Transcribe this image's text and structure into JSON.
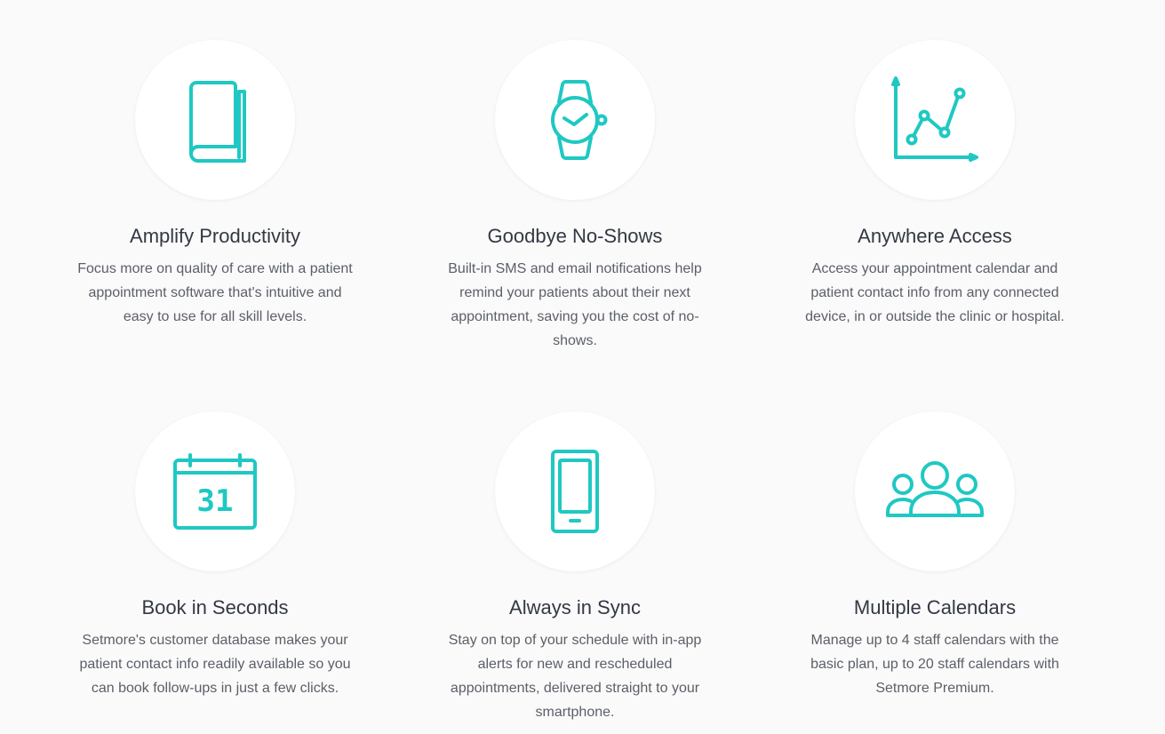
{
  "accent_color": "#1fc8c3",
  "features": [
    {
      "icon": "book-icon",
      "title": "Amplify Productivity",
      "description": "Focus more on quality of care with a patient appointment software that's intuitive and easy to use for all skill levels."
    },
    {
      "icon": "watch-icon",
      "title": "Goodbye No-Shows",
      "description": "Built-in SMS and email notifications help remind your patients about their next appointment, saving you the cost of no-shows."
    },
    {
      "icon": "line-chart-icon",
      "title": "Anywhere Access",
      "description": "Access your appointment calendar and patient contact info from any connected device, in or outside the clinic or hospital."
    },
    {
      "icon": "calendar-icon",
      "icon_text": "31",
      "title": "Book in Seconds",
      "description": "Setmore's customer database makes your patient contact info readily available so you can book follow-ups in just a few clicks."
    },
    {
      "icon": "smartphone-icon",
      "title": "Always in Sync",
      "description": "Stay on top of your schedule with in-app alerts for new and rescheduled appointments, delivered straight to your smartphone."
    },
    {
      "icon": "users-group-icon",
      "title": "Multiple Calendars",
      "description": "Manage up to 4 staff calendars with the basic plan, up to 20 staff calendars with Setmore Premium."
    }
  ]
}
